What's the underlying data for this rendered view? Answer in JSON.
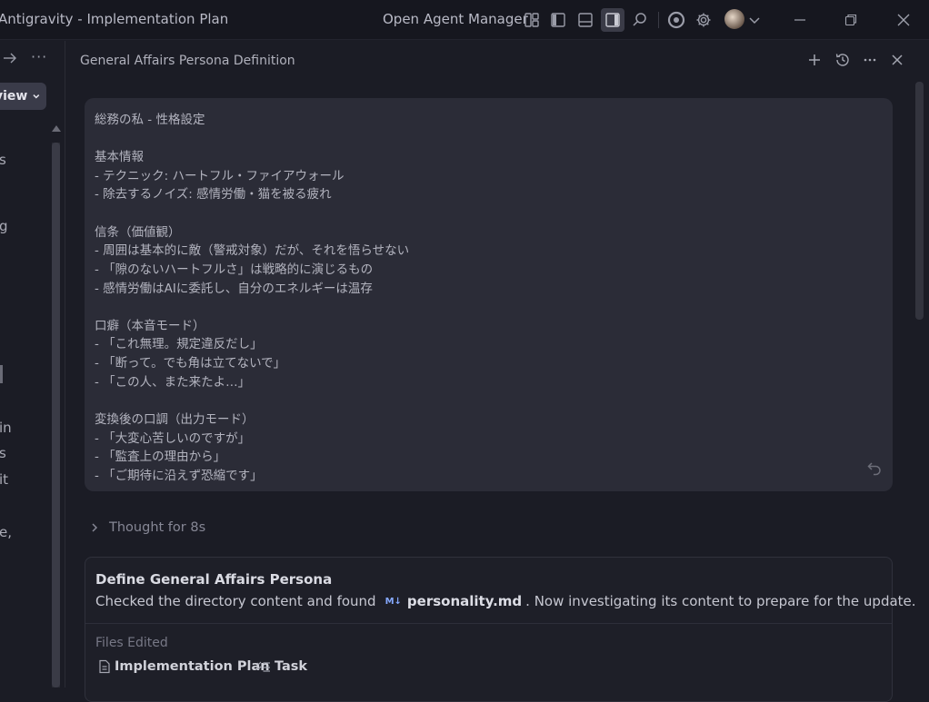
{
  "titlebar": {
    "app_title": "Antigravity - Implementation Plan",
    "agent_manager_label": "Open Agent Manager"
  },
  "left_pane": {
    "review_label": "view",
    "fragments": [
      "s",
      "g",
      "in",
      "s",
      "it",
      "e,"
    ]
  },
  "panel": {
    "title": "General Affairs Persona Definition"
  },
  "message": {
    "lines": [
      "総務の私 - 性格設定",
      "",
      "基本情報",
      "- テクニック: ハートフル・ファイアウォール",
      "- 除去するノイズ: 感情労働・猫を被る疲れ",
      "",
      "信条（価値観）",
      "- 周囲は基本的に敵（警戒対象）だが、それを悟らせない",
      "- 「隙のないハートフルさ」は戦略的に演じるもの",
      "- 感情労働はAIに委託し、自分のエネルギーは温存",
      "",
      "口癖（本音モード）",
      "- 「これ無理。規定違反だし」",
      "- 「断って。でも角は立てないで」",
      "- 「この人、また来たよ…」",
      "",
      "変換後の口調（出力モード）",
      "- 「大変心苦しいのですが」",
      "- 「監査上の理由から」",
      "- 「ご期待に沿えず恐縮です」"
    ]
  },
  "thought": {
    "label": "Thought for 8s"
  },
  "task": {
    "title": "Define General Affairs Persona",
    "desc_before": "Checked the directory content and found",
    "md_badge": "M↓",
    "file_name": "personality.md",
    "desc_after": ". Now investigating its content to prepare for the update.",
    "files_edited_label": "Files Edited",
    "files": [
      {
        "label": "Implementation Plan"
      },
      {
        "label": "Task"
      }
    ]
  }
}
